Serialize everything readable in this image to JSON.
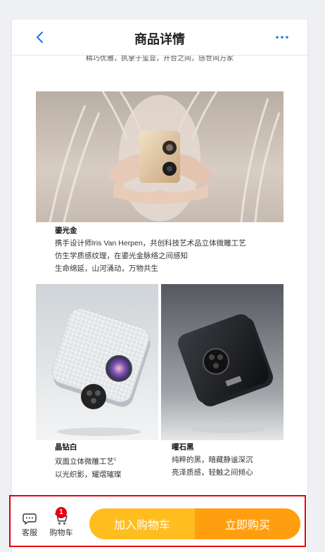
{
  "nav": {
    "title": "商品详情",
    "back_icon": "chevron-left-icon",
    "more_icon": "ellipsis-icon"
  },
  "content": {
    "tagline": "精巧优雅，执掌于玺显，开合之间，感世间万家",
    "sections": [
      {
        "title": "鎏光金",
        "lines": [
          "携手设计师Iris Van Herpen，共创科技艺术品立体微雕工艺",
          "仿生学质感纹理，在鎏光金脉络之间感知",
          "生命绵延，山河涌动，万物共生"
        ]
      },
      {
        "title": "晶钻白",
        "lines": [
          "双面立体微雕工艺",
          "以光织影，耀熠璀璨"
        ],
        "footnote": "1"
      },
      {
        "title": "曜石黑",
        "lines": [
          "纯粹的黑，暗藏静谧深沉",
          "亮泽质感，轻触之间倾心"
        ]
      }
    ]
  },
  "bottom_bar": {
    "service_label": "客服",
    "cart_label": "购物车",
    "cart_count": "1",
    "add_to_cart": "加入购物车",
    "buy_now": "立即购买"
  },
  "colors": {
    "accent_blue": "#1a73e8",
    "add_button": "#ffbd1f",
    "buy_button": "#ff9f0f",
    "badge": "#e60012",
    "highlight_border": "#e60012"
  }
}
